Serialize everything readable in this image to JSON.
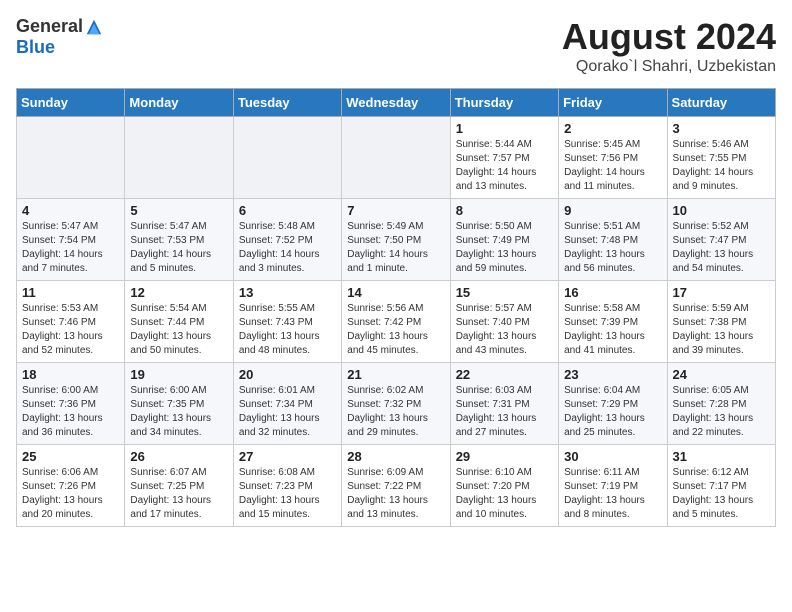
{
  "header": {
    "logo_general": "General",
    "logo_blue": "Blue",
    "month_title": "August 2024",
    "location": "Qorako`l Shahri, Uzbekistan"
  },
  "weekdays": [
    "Sunday",
    "Monday",
    "Tuesday",
    "Wednesday",
    "Thursday",
    "Friday",
    "Saturday"
  ],
  "weeks": [
    [
      {
        "day": "",
        "info": ""
      },
      {
        "day": "",
        "info": ""
      },
      {
        "day": "",
        "info": ""
      },
      {
        "day": "",
        "info": ""
      },
      {
        "day": "1",
        "info": "Sunrise: 5:44 AM\nSunset: 7:57 PM\nDaylight: 14 hours\nand 13 minutes."
      },
      {
        "day": "2",
        "info": "Sunrise: 5:45 AM\nSunset: 7:56 PM\nDaylight: 14 hours\nand 11 minutes."
      },
      {
        "day": "3",
        "info": "Sunrise: 5:46 AM\nSunset: 7:55 PM\nDaylight: 14 hours\nand 9 minutes."
      }
    ],
    [
      {
        "day": "4",
        "info": "Sunrise: 5:47 AM\nSunset: 7:54 PM\nDaylight: 14 hours\nand 7 minutes."
      },
      {
        "day": "5",
        "info": "Sunrise: 5:47 AM\nSunset: 7:53 PM\nDaylight: 14 hours\nand 5 minutes."
      },
      {
        "day": "6",
        "info": "Sunrise: 5:48 AM\nSunset: 7:52 PM\nDaylight: 14 hours\nand 3 minutes."
      },
      {
        "day": "7",
        "info": "Sunrise: 5:49 AM\nSunset: 7:50 PM\nDaylight: 14 hours\nand 1 minute."
      },
      {
        "day": "8",
        "info": "Sunrise: 5:50 AM\nSunset: 7:49 PM\nDaylight: 13 hours\nand 59 minutes."
      },
      {
        "day": "9",
        "info": "Sunrise: 5:51 AM\nSunset: 7:48 PM\nDaylight: 13 hours\nand 56 minutes."
      },
      {
        "day": "10",
        "info": "Sunrise: 5:52 AM\nSunset: 7:47 PM\nDaylight: 13 hours\nand 54 minutes."
      }
    ],
    [
      {
        "day": "11",
        "info": "Sunrise: 5:53 AM\nSunset: 7:46 PM\nDaylight: 13 hours\nand 52 minutes."
      },
      {
        "day": "12",
        "info": "Sunrise: 5:54 AM\nSunset: 7:44 PM\nDaylight: 13 hours\nand 50 minutes."
      },
      {
        "day": "13",
        "info": "Sunrise: 5:55 AM\nSunset: 7:43 PM\nDaylight: 13 hours\nand 48 minutes."
      },
      {
        "day": "14",
        "info": "Sunrise: 5:56 AM\nSunset: 7:42 PM\nDaylight: 13 hours\nand 45 minutes."
      },
      {
        "day": "15",
        "info": "Sunrise: 5:57 AM\nSunset: 7:40 PM\nDaylight: 13 hours\nand 43 minutes."
      },
      {
        "day": "16",
        "info": "Sunrise: 5:58 AM\nSunset: 7:39 PM\nDaylight: 13 hours\nand 41 minutes."
      },
      {
        "day": "17",
        "info": "Sunrise: 5:59 AM\nSunset: 7:38 PM\nDaylight: 13 hours\nand 39 minutes."
      }
    ],
    [
      {
        "day": "18",
        "info": "Sunrise: 6:00 AM\nSunset: 7:36 PM\nDaylight: 13 hours\nand 36 minutes."
      },
      {
        "day": "19",
        "info": "Sunrise: 6:00 AM\nSunset: 7:35 PM\nDaylight: 13 hours\nand 34 minutes."
      },
      {
        "day": "20",
        "info": "Sunrise: 6:01 AM\nSunset: 7:34 PM\nDaylight: 13 hours\nand 32 minutes."
      },
      {
        "day": "21",
        "info": "Sunrise: 6:02 AM\nSunset: 7:32 PM\nDaylight: 13 hours\nand 29 minutes."
      },
      {
        "day": "22",
        "info": "Sunrise: 6:03 AM\nSunset: 7:31 PM\nDaylight: 13 hours\nand 27 minutes."
      },
      {
        "day": "23",
        "info": "Sunrise: 6:04 AM\nSunset: 7:29 PM\nDaylight: 13 hours\nand 25 minutes."
      },
      {
        "day": "24",
        "info": "Sunrise: 6:05 AM\nSunset: 7:28 PM\nDaylight: 13 hours\nand 22 minutes."
      }
    ],
    [
      {
        "day": "25",
        "info": "Sunrise: 6:06 AM\nSunset: 7:26 PM\nDaylight: 13 hours\nand 20 minutes."
      },
      {
        "day": "26",
        "info": "Sunrise: 6:07 AM\nSunset: 7:25 PM\nDaylight: 13 hours\nand 17 minutes."
      },
      {
        "day": "27",
        "info": "Sunrise: 6:08 AM\nSunset: 7:23 PM\nDaylight: 13 hours\nand 15 minutes."
      },
      {
        "day": "28",
        "info": "Sunrise: 6:09 AM\nSunset: 7:22 PM\nDaylight: 13 hours\nand 13 minutes."
      },
      {
        "day": "29",
        "info": "Sunrise: 6:10 AM\nSunset: 7:20 PM\nDaylight: 13 hours\nand 10 minutes."
      },
      {
        "day": "30",
        "info": "Sunrise: 6:11 AM\nSunset: 7:19 PM\nDaylight: 13 hours\nand 8 minutes."
      },
      {
        "day": "31",
        "info": "Sunrise: 6:12 AM\nSunset: 7:17 PM\nDaylight: 13 hours\nand 5 minutes."
      }
    ]
  ]
}
